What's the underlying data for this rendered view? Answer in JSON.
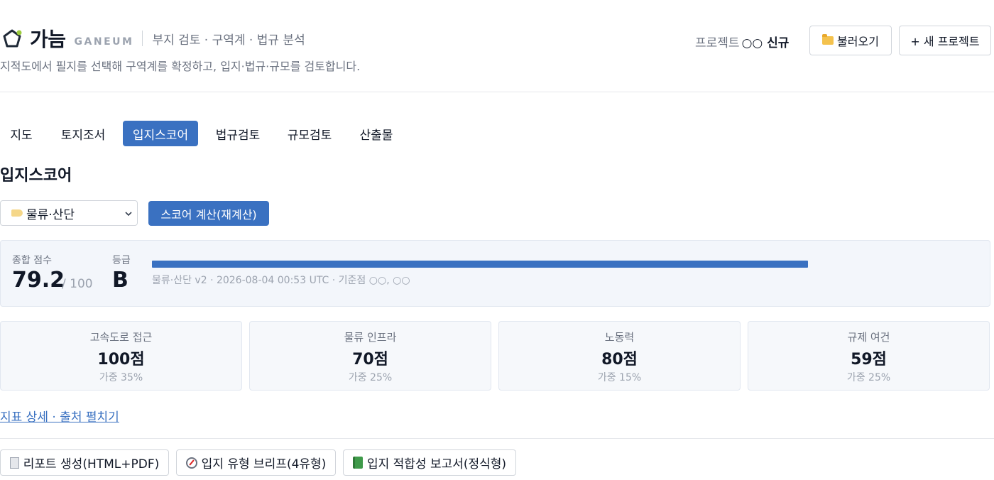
{
  "header": {
    "brand_name": "가늠",
    "brand_sub": "GANEUM",
    "tagline": "부지 검토 · 구역계 · 법규 분석",
    "subtitle": "지적도에서 필지를 선택해 구역계를 확정하고, 입지·법규·규모를 검토합니다.",
    "project_label": "프로젝트",
    "project_name": "○○ 신규",
    "load_button": "불러오기",
    "new_project_button": "+ 새 프로젝트",
    "icons": {
      "logo": "pentagon-logo-icon",
      "load": "folder-icon"
    }
  },
  "tabs": [
    {
      "label": "지도",
      "active": false
    },
    {
      "label": "토지조서",
      "active": false
    },
    {
      "label": "입지스코어",
      "active": true
    },
    {
      "label": "법규검토",
      "active": false
    },
    {
      "label": "규모검토",
      "active": false
    },
    {
      "label": "산출물",
      "active": false
    }
  ],
  "main": {
    "title": "입지스코어",
    "preset_select": {
      "value": "물류·산단",
      "icon": "tag-icon"
    },
    "calc_button": "스코어 계산(재계산)",
    "summary": {
      "total_label": "종합 점수",
      "total_score": "79.2",
      "total_max": "/ 100",
      "grade_label": "등급",
      "grade": "B",
      "progress_fraction": 0.792,
      "meta": "물류·산단 v2 · 2026-08-04 00:53 UTC · 기준점 ○○, ○○"
    },
    "metrics": [
      {
        "label": "고속도로 접근",
        "value": "100점",
        "weight": "가중 35%"
      },
      {
        "label": "물류 인프라",
        "value": "70점",
        "weight": "가중 25%"
      },
      {
        "label": "노동력",
        "value": "80점",
        "weight": "가중 15%"
      },
      {
        "label": "규제 여건",
        "value": "59점",
        "weight": "가중 25%"
      }
    ],
    "details_link": "지표 상세 · 출처 펼치기",
    "report_buttons": [
      {
        "label": "리포트 생성(HTML+PDF)",
        "icon": "document-icon"
      },
      {
        "label": "입지 유형 브리프(4유형)",
        "icon": "compass-icon"
      },
      {
        "label": "입지 적합성 보고서(정식형)",
        "icon": "book-icon"
      }
    ]
  },
  "colors": {
    "accent": "#3a71c1",
    "panel_bg": "#f3f6fb",
    "muted_text": "#6b7280"
  }
}
